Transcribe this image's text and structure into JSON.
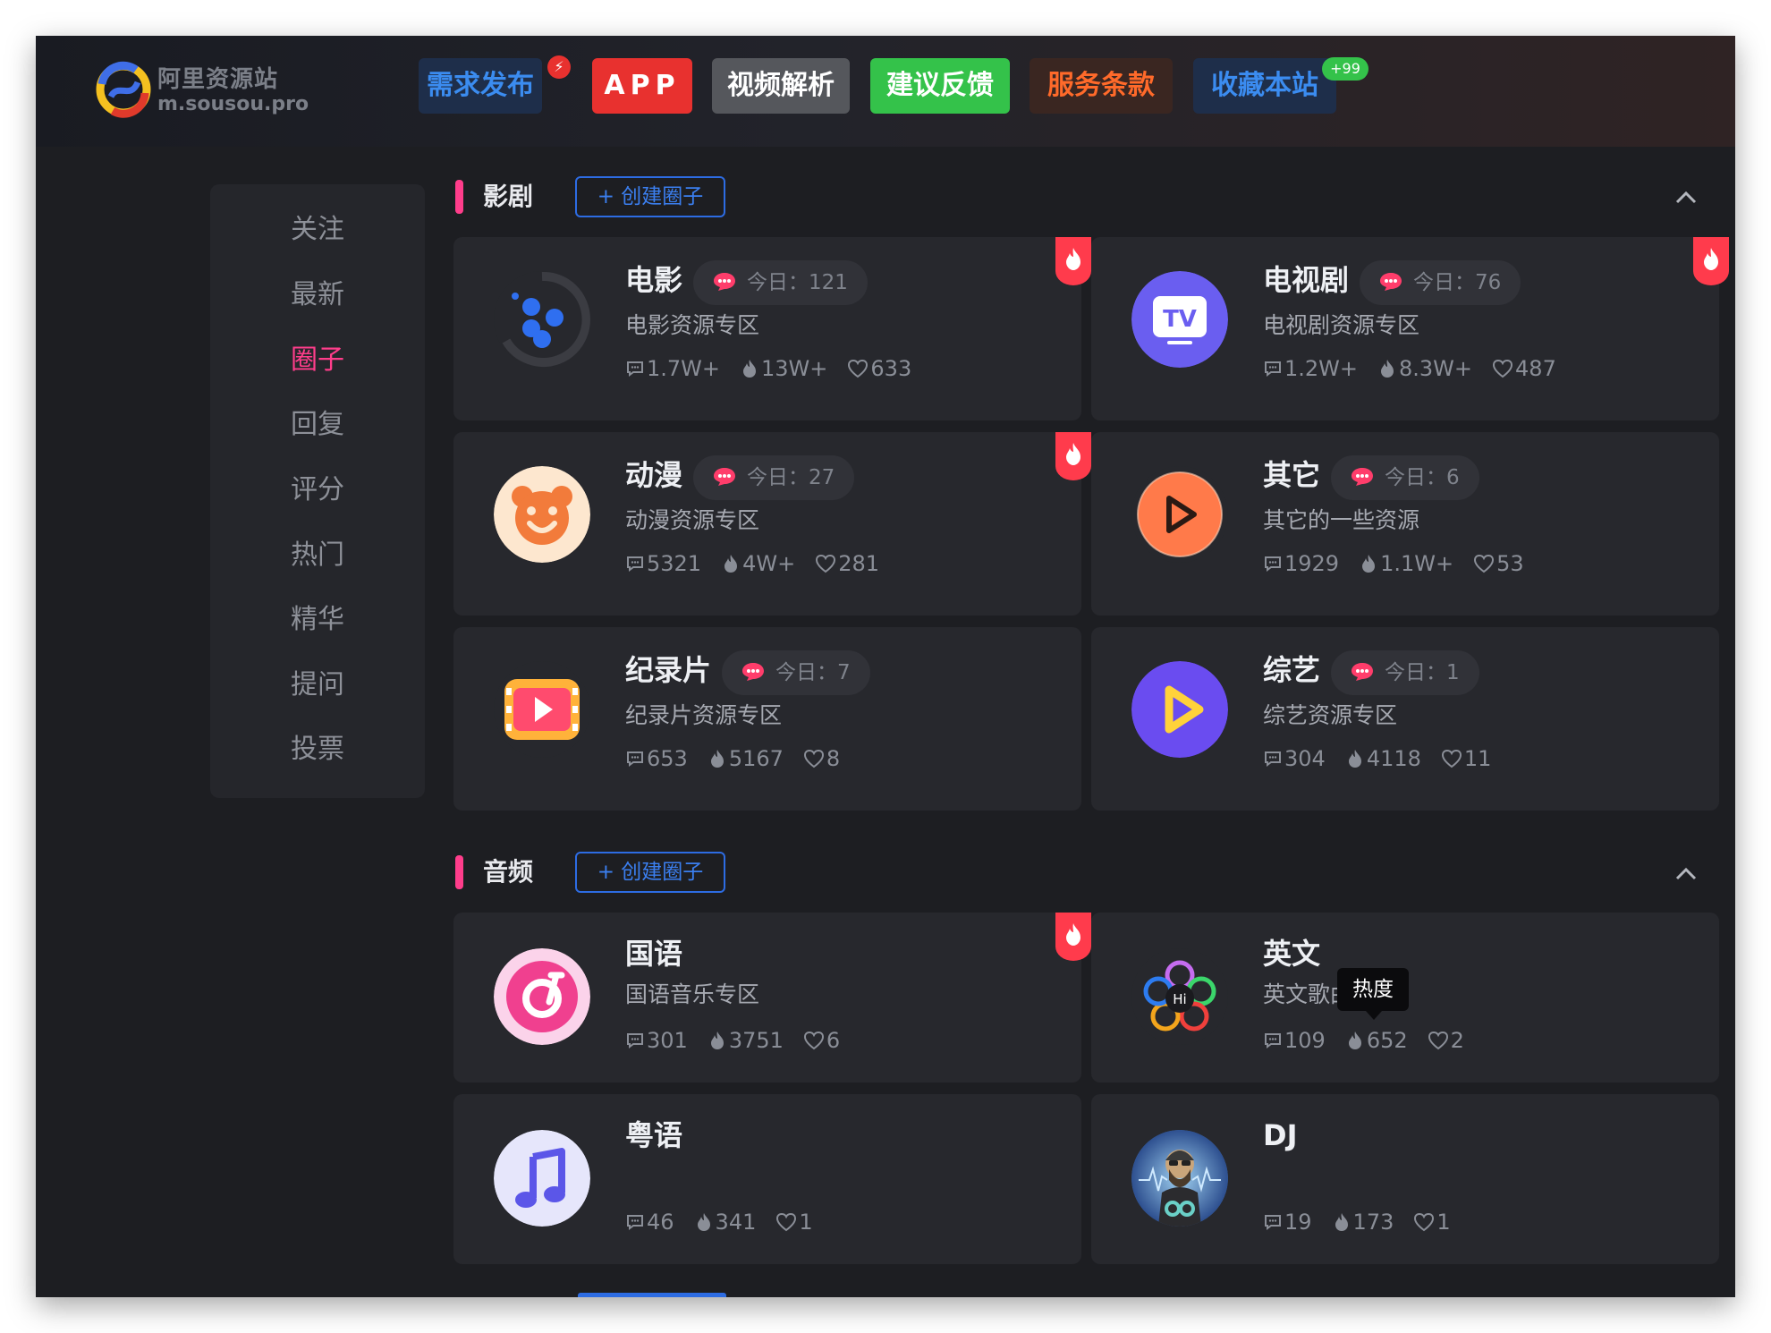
{
  "site": {
    "name": "阿里资源站",
    "domain": "m.sousou.pro"
  },
  "nav": [
    {
      "label": "需求发布",
      "badge": "⚡",
      "color": "#3b8cf0",
      "bg": "#1e2e4a"
    },
    {
      "label": "APP",
      "color": "#ffffff",
      "bg": "#e8312f"
    },
    {
      "label": "视频解析",
      "color": "#ffffff",
      "bg": "#55575c"
    },
    {
      "label": "建议反馈",
      "color": "#ffffff",
      "bg": "#34c24a"
    },
    {
      "label": "服务条款",
      "color": "#ff6a2a",
      "bg": "#3a2621"
    },
    {
      "label": "收藏本站",
      "badge": "+99",
      "color": "#3b8cf0",
      "bg": "#1e2e4a"
    }
  ],
  "sidebar": {
    "items": [
      "关注",
      "最新",
      "圈子",
      "回复",
      "评分",
      "热门",
      "精华",
      "提问",
      "投票"
    ],
    "active": "圈子"
  },
  "sections": [
    {
      "title": "影剧",
      "create_label": "+ 创建圈子",
      "cards": [
        {
          "name": "电影",
          "today": "今日：121",
          "desc": "电影资源专区",
          "comments": "1.7W+",
          "heat": "13W+",
          "likes": "633",
          "hot": true,
          "icon": "film-reel-icon"
        },
        {
          "name": "电视剧",
          "today": "今日：76",
          "desc": "电视剧资源专区",
          "comments": "1.2W+",
          "heat": "8.3W+",
          "likes": "487",
          "hot": true,
          "icon": "tv-icon"
        },
        {
          "name": "动漫",
          "today": "今日：27",
          "desc": "动漫资源专区",
          "comments": "5321",
          "heat": "4W+",
          "likes": "281",
          "hot": true,
          "icon": "bear-icon"
        },
        {
          "name": "其它",
          "today": "今日：6",
          "desc": "其它的一些资源",
          "comments": "1929",
          "heat": "1.1W+",
          "likes": "53",
          "hot": false,
          "icon": "play-icon"
        },
        {
          "name": "纪录片",
          "today": "今日：7",
          "desc": "纪录片资源专区",
          "comments": "653",
          "heat": "5167",
          "likes": "8",
          "hot": false,
          "icon": "film-play-icon"
        },
        {
          "name": "综艺",
          "today": "今日：1",
          "desc": "综艺资源专区",
          "comments": "304",
          "heat": "4118",
          "likes": "11",
          "hot": false,
          "icon": "purple-play-icon"
        }
      ]
    },
    {
      "title": "音频",
      "create_label": "+ 创建圈子",
      "cards": [
        {
          "name": "国语",
          "desc": "国语音乐专区",
          "comments": "301",
          "heat": "3751",
          "likes": "6",
          "hot": true,
          "icon": "music-disc-icon"
        },
        {
          "name": "英文",
          "desc": "英文歌曲",
          "comments": "109",
          "heat": "652",
          "likes": "2",
          "hot": false,
          "icon": "hi-flower-icon"
        },
        {
          "name": "粤语",
          "desc": "",
          "comments": "46",
          "heat": "341",
          "likes": "1",
          "hot": false,
          "icon": "music-note-icon"
        },
        {
          "name": "DJ",
          "desc": "",
          "comments": "19",
          "heat": "173",
          "likes": "1",
          "hot": false,
          "icon": "dj-avatar-icon"
        }
      ]
    }
  ],
  "tooltip": "热度"
}
